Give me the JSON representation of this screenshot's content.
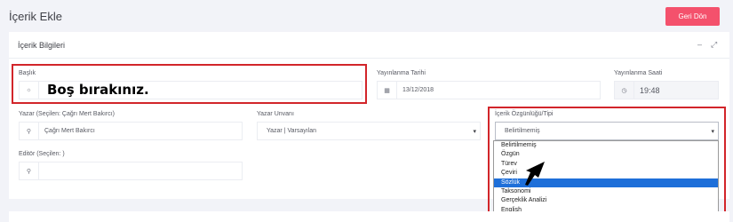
{
  "page": {
    "title": "İçerik Ekle",
    "back_label": "Geri Dön"
  },
  "card": {
    "title": "İçerik Bilgileri",
    "minimize_icon": "–",
    "expand_icon": "⤢"
  },
  "form": {
    "title_label": "Başlık",
    "title_note": "Boş bırakınız.",
    "date_label": "Yayınlanma Tarihi",
    "date_value": "13/12/2018",
    "time_label": "Yayınlanma Saati",
    "time_value": "19:48",
    "author_label": "Yazar (Seçilen: Çağrı Mert Bakırcı)",
    "author_value": "Çağrı Mert Bakırcı",
    "author_title_label": "Yazar Unvanı",
    "author_title_value": "Yazar | Varsayılan",
    "type_label": "İçerik Özgünlüğü/Tipi",
    "type_value": "Belirtilmemiş",
    "editor_label": "Editör (Seçilen: )",
    "editor_value": ""
  },
  "type_options": [
    "Belirtilmemiş",
    "Özgün",
    "Türev",
    "Çeviri",
    "Sözlük",
    "Taksonomi",
    "Gerçeklik Analizi",
    "English"
  ],
  "selected_option_index": 4,
  "colors": {
    "accent": "#f4516c",
    "highlight": "#d2252a",
    "selection": "#1e6fd9"
  }
}
